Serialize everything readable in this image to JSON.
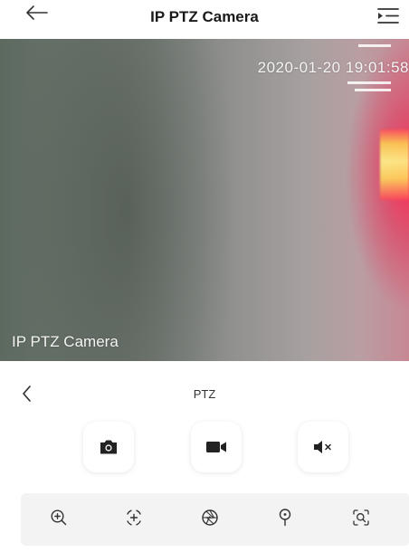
{
  "header": {
    "title": "IP PTZ Camera",
    "back_icon": "arrow-left-icon",
    "menu_icon": "list-menu-icon"
  },
  "video": {
    "timestamp": "2020-01-20 19:01:58",
    "camera_name": "IP PTZ Camera"
  },
  "panel": {
    "title": "PTZ",
    "back_icon": "chevron-left-icon",
    "actions": [
      {
        "icon": "camera-icon",
        "name": "snapshot-button"
      },
      {
        "icon": "video-camera-icon",
        "name": "record-button"
      },
      {
        "icon": "speaker-mute-icon",
        "name": "mute-button"
      }
    ],
    "tools": [
      {
        "icon": "zoom-in-icon",
        "name": "zoom-in-button"
      },
      {
        "icon": "focus-plus-icon",
        "name": "focus-button"
      },
      {
        "icon": "aperture-icon",
        "name": "iris-button"
      },
      {
        "icon": "preset-pin-icon",
        "name": "preset-button"
      },
      {
        "icon": "zoom-search-icon",
        "name": "zoom-search-button"
      }
    ]
  },
  "colors": {
    "text": "#1a1a1a",
    "icon": "#333333",
    "toolbar_bg": "#f3f3f4"
  }
}
